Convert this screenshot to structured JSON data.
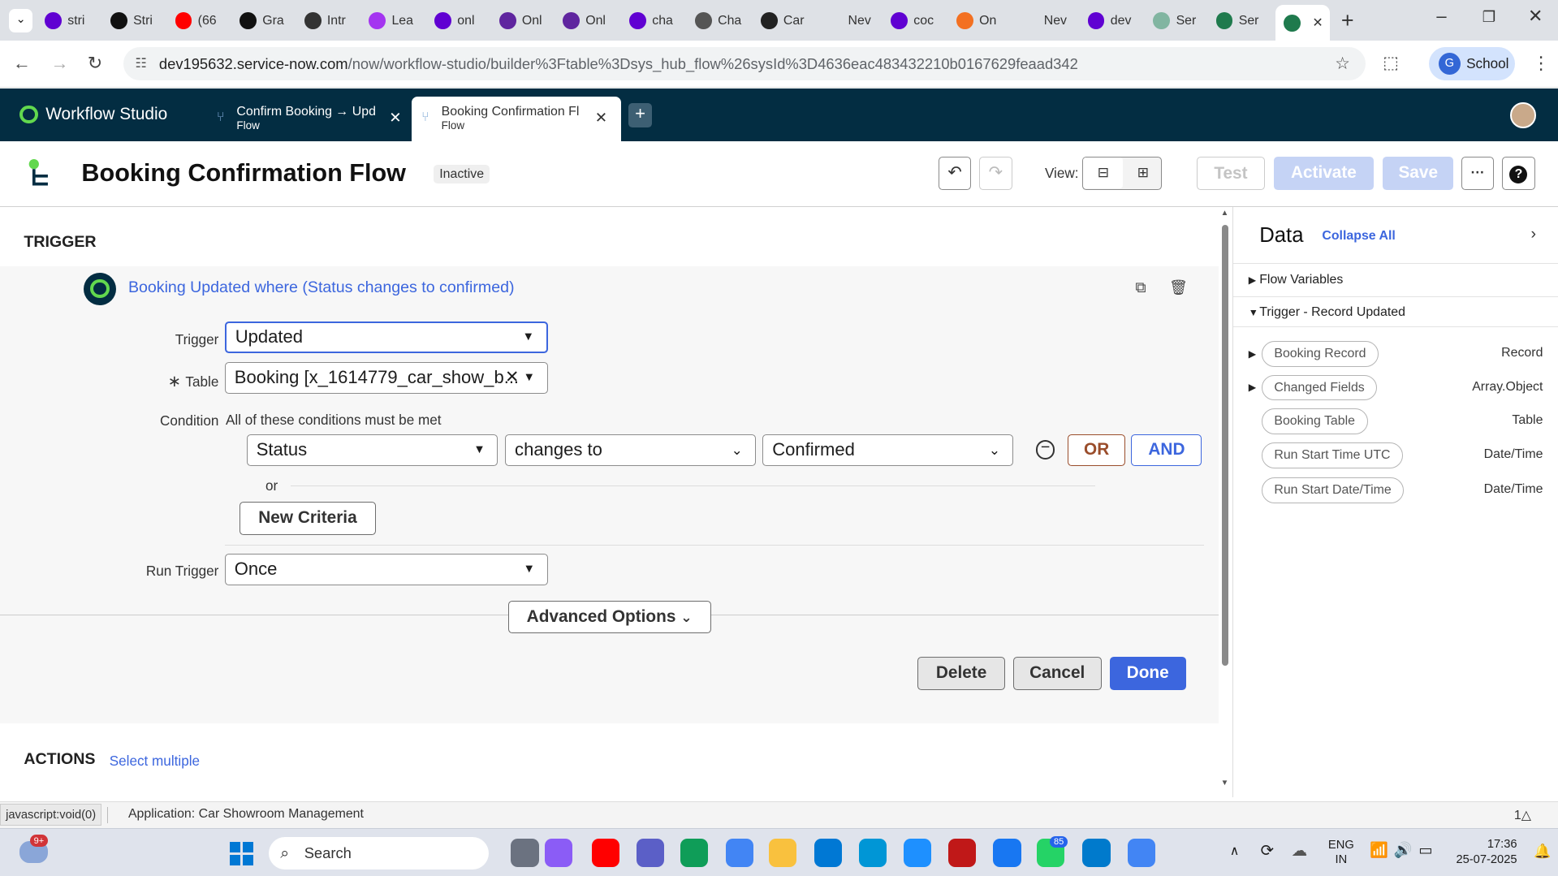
{
  "browser": {
    "tabs": [
      {
        "label": "stri",
        "icon": "yahoo-icon",
        "color": "#6001d2"
      },
      {
        "label": "Stri",
        "icon": "tuf-icon",
        "color": "#111111"
      },
      {
        "label": "(66",
        "icon": "youtube-icon",
        "color": "#ff0000"
      },
      {
        "label": "Gra",
        "icon": "tuf-icon",
        "color": "#111111"
      },
      {
        "label": "Intr",
        "icon": "scaler-icon",
        "color": "#333333"
      },
      {
        "label": "Lea",
        "icon": "udemy-icon",
        "color": "#a435f0"
      },
      {
        "label": "onl",
        "icon": "yahoo-icon",
        "color": "#6001d2"
      },
      {
        "label": "Onl",
        "icon": "phonepe-icon",
        "color": "#5f259f"
      },
      {
        "label": "Onl",
        "icon": "phonepe-icon",
        "color": "#5f259f"
      },
      {
        "label": "cha",
        "icon": "yahoo-icon",
        "color": "#6001d2"
      },
      {
        "label": "Cha",
        "icon": "chatgpt-icon",
        "color": "#555555"
      },
      {
        "label": "Car",
        "icon": "openai-icon",
        "color": "#222222"
      },
      {
        "label": "Nev",
        "icon": "blank-icon",
        "color": "#dee1e6"
      },
      {
        "label": "coc",
        "icon": "yahoo-icon",
        "color": "#6001d2"
      },
      {
        "label": "On",
        "icon": "codingninja-icon",
        "color": "#f37021"
      },
      {
        "label": "Nev",
        "icon": "blank-icon",
        "color": "#dee1e6"
      },
      {
        "label": "dev",
        "icon": "yahoo-icon",
        "color": "#6001d2"
      },
      {
        "label": "Ser",
        "icon": "servicenow-icon",
        "color": "#81b5a1"
      },
      {
        "label": "Ser",
        "icon": "servicenow-icon",
        "color": "#1f7a4d"
      }
    ],
    "url_host": "dev195632.service-now.com",
    "url_path": "/now/workflow-studio/builder%3Ftable%3Dsys_hub_flow%26sysId%3D4636eac483432210b0167629feaad342",
    "profile_label": "School",
    "profile_initial": "G"
  },
  "studio": {
    "brand": "Workflow Studio",
    "tabs": [
      {
        "title": "Confirm Booking → Upd",
        "subtitle": "Flow"
      },
      {
        "title": "Booking Confirmation Fl",
        "subtitle": "Flow"
      }
    ]
  },
  "flow": {
    "title": "Booking Confirmation Flow",
    "status": "Inactive",
    "view_label": "View:",
    "test": "Test",
    "activate": "Activate",
    "save": "Save",
    "more": "···",
    "help": "?"
  },
  "trigger": {
    "section_title": "TRIGGER",
    "summary": "Booking Updated where (Status changes to confirmed)",
    "trigger_label": "Trigger",
    "trigger_value": "Updated",
    "table_label": "Table",
    "table_value": "Booking [x_1614779_car_show_b...",
    "condition_label": "Condition",
    "condition_text": "All of these conditions must be met",
    "cond_field": "Status",
    "cond_operator": "changes to",
    "cond_value": "Confirmed",
    "or_btn": "OR",
    "and_btn": "AND",
    "or_text": "or",
    "new_criteria": "New Criteria",
    "run_label": "Run Trigger",
    "run_value": "Once",
    "advanced": "Advanced Options",
    "delete": "Delete",
    "cancel": "Cancel",
    "done": "Done"
  },
  "actions": {
    "title": "ACTIONS",
    "select_multiple": "Select multiple"
  },
  "data_panel": {
    "title": "Data",
    "collapse_all": "Collapse All",
    "flow_variables": "Flow Variables",
    "trigger_group": "Trigger - Record Updated",
    "pills": [
      {
        "name": "Booking Record",
        "type": "Record"
      },
      {
        "name": "Changed Fields",
        "type": "Array.Object"
      },
      {
        "name": "Booking Table",
        "type": "Table"
      },
      {
        "name": "Run Start Time UTC",
        "type": "Date/Time"
      },
      {
        "name": "Run Start Date/Time",
        "type": "Date/Time"
      }
    ]
  },
  "statusbar": {
    "link": "javascript:void(0)",
    "application": "Application: Car Showroom Management",
    "notifications": "1"
  },
  "taskbar": {
    "weather_badge": "9+",
    "search": "Search",
    "whatsapp_badge": "85",
    "lang": "ENG",
    "region": "IN",
    "time": "17:36",
    "date": "25-07-2025"
  },
  "colors": {
    "studio_header": "#032d42",
    "primary": "#3c66de",
    "disabled_btn": "#c5d3f5",
    "or_btn": "#9a4d2b",
    "link": "#3c66de"
  }
}
